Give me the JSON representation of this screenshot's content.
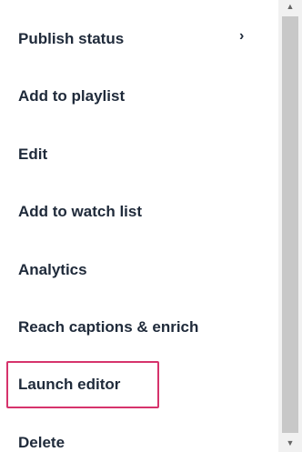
{
  "menu": {
    "items": [
      {
        "label": "Publish status",
        "has_submenu": true
      },
      {
        "label": "Add to playlist"
      },
      {
        "label": "Edit"
      },
      {
        "label": "Add to watch list"
      },
      {
        "label": "Analytics"
      },
      {
        "label": "Reach captions & enrich"
      },
      {
        "label": "Launch editor",
        "highlighted": true
      },
      {
        "label": "Delete"
      }
    ],
    "submenu_icon": "chevron-right-icon",
    "highlight_color": "#d6336c",
    "text_color": "#1f2a3a"
  },
  "scrollbar": {
    "up_arrow": "▲",
    "down_arrow": "▼"
  }
}
